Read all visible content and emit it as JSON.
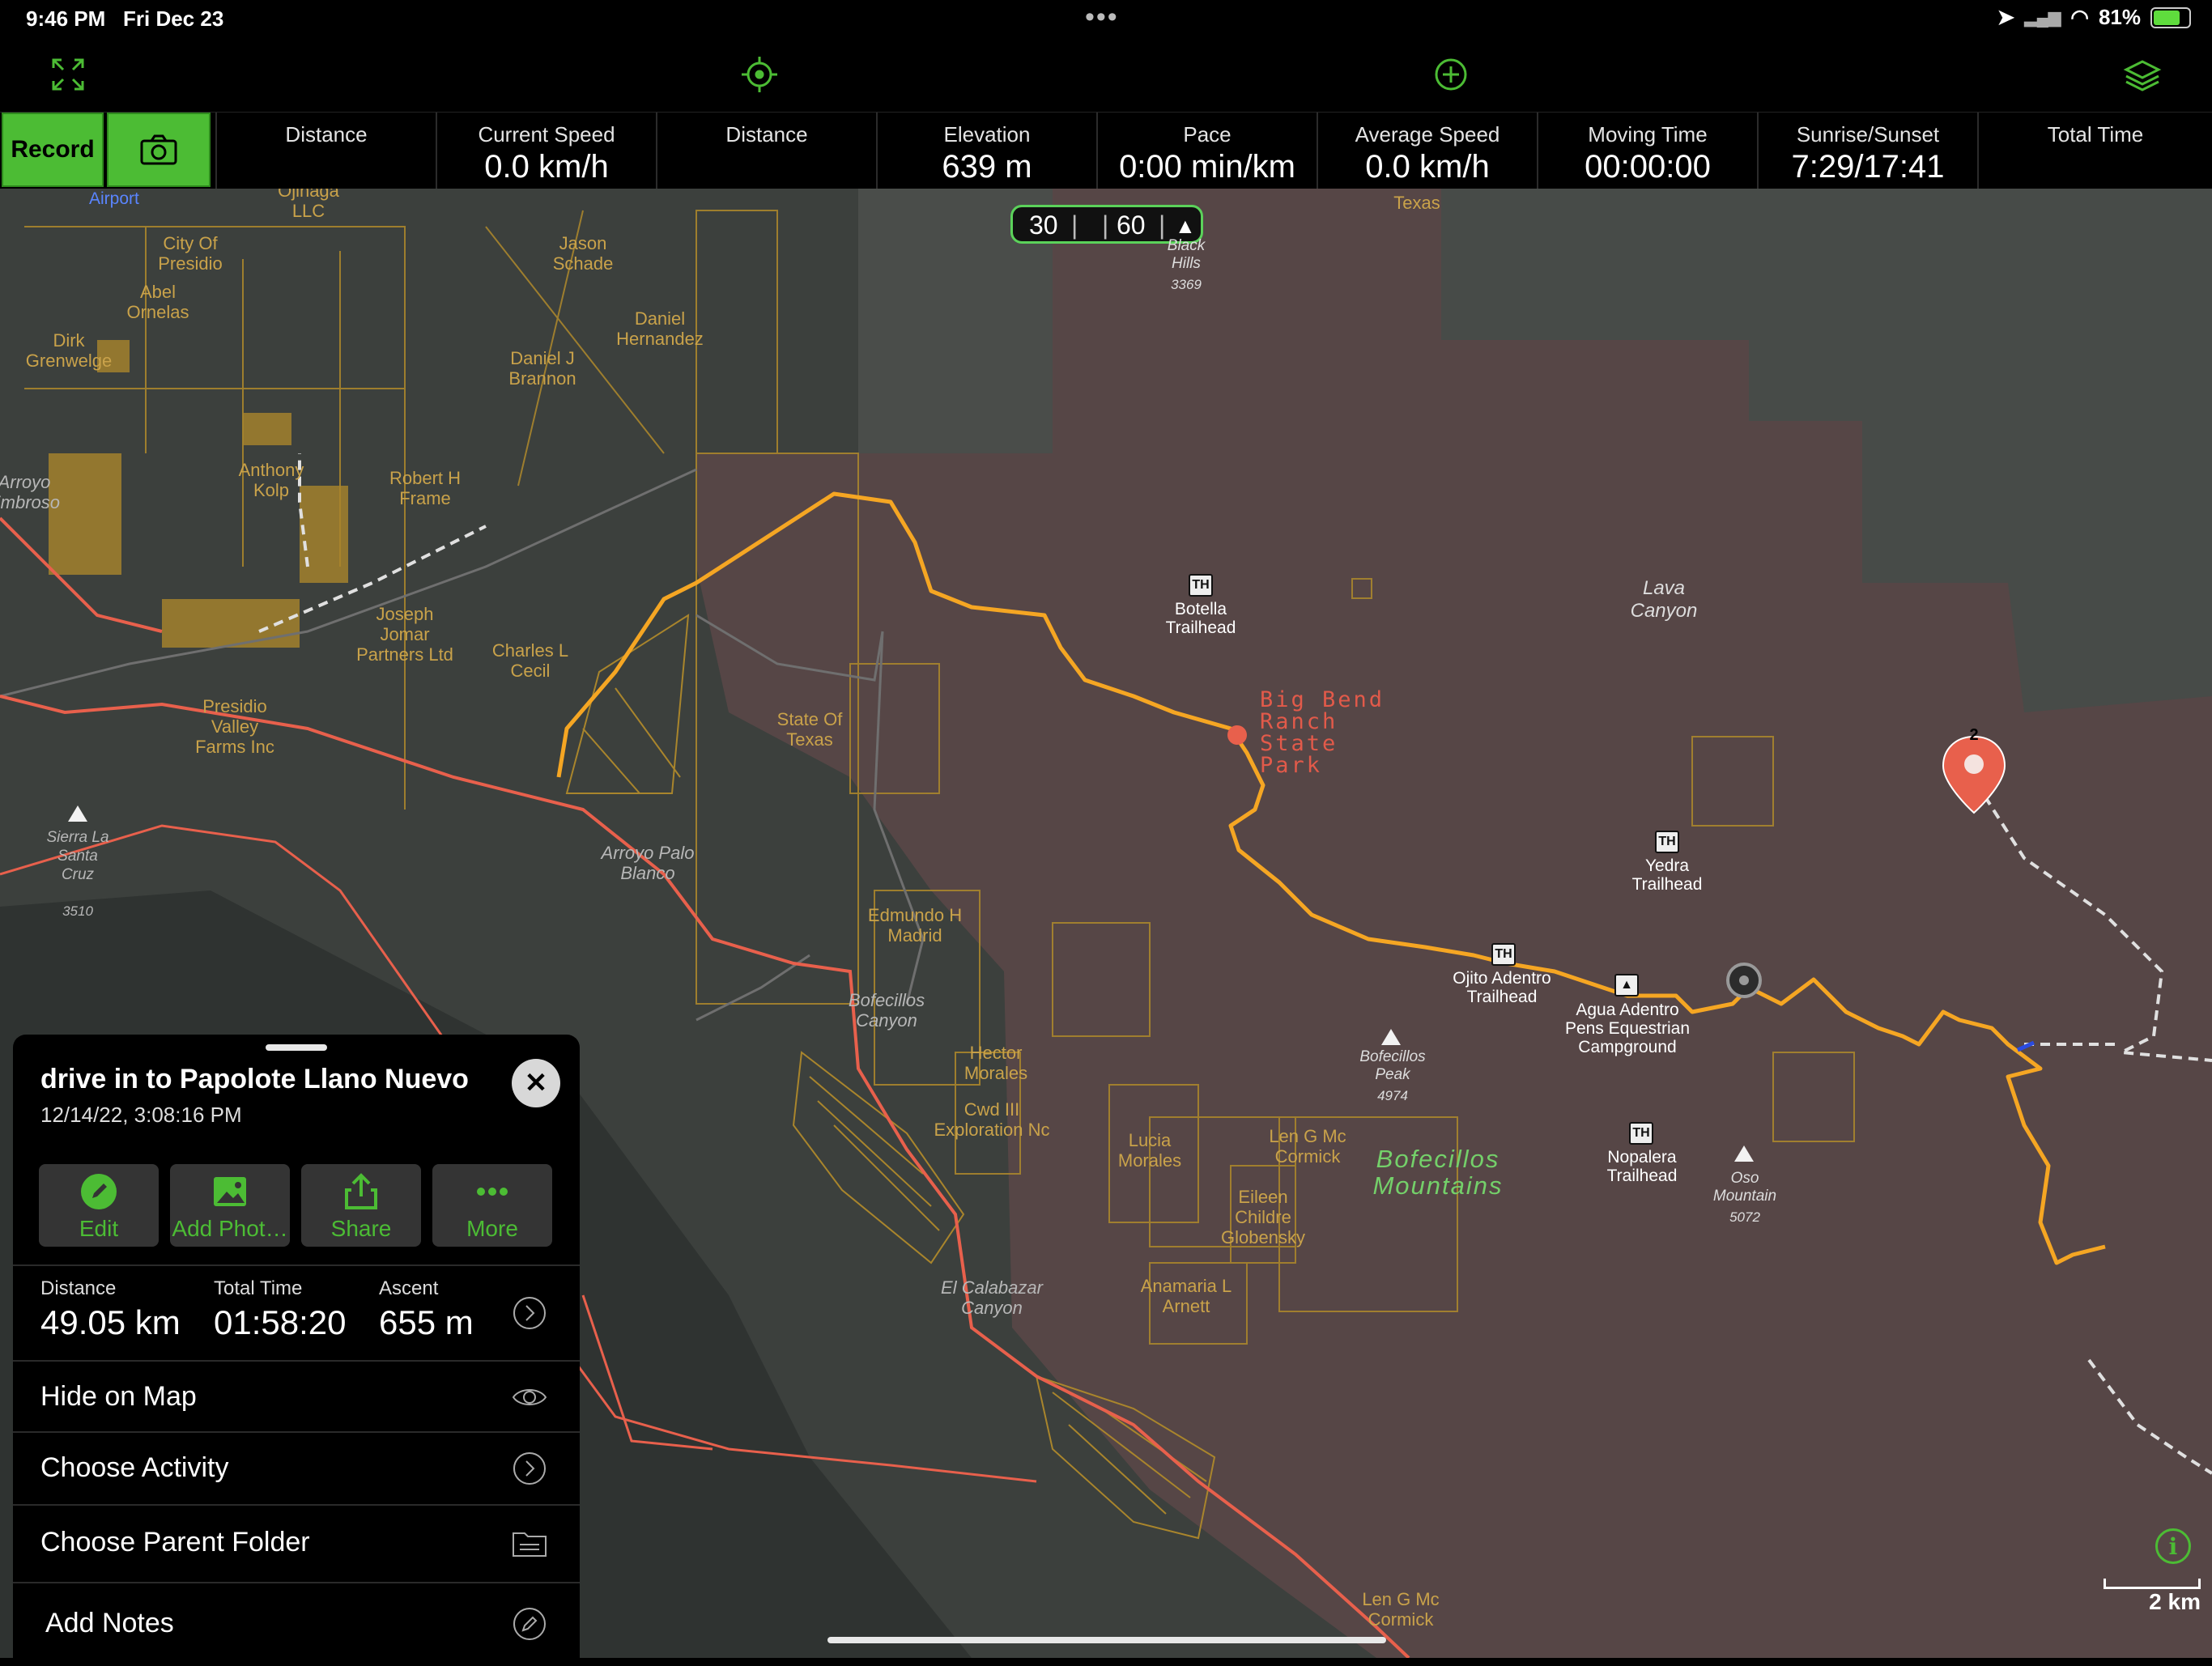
{
  "status_bar": {
    "time": "9:46 PM",
    "date": "Fri Dec 23",
    "dots": "•••",
    "battery": "81%",
    "battery_level": 0.81
  },
  "stats": {
    "record_label": "Record",
    "items": [
      {
        "label": "Distance",
        "value": ""
      },
      {
        "label": "Current Speed",
        "value": "0.0 km/h"
      },
      {
        "label": "Distance",
        "value": ""
      },
      {
        "label": "Elevation",
        "value": "639 m"
      },
      {
        "label": "Pace",
        "value": "0:00 min/km"
      },
      {
        "label": "Average Speed",
        "value": "0.0 km/h"
      },
      {
        "label": "Moving Time",
        "value": "00:00:00"
      },
      {
        "label": "Sunrise/Sunset",
        "value": "7:29/17:41"
      },
      {
        "label": "Total Time",
        "value": ""
      }
    ]
  },
  "map": {
    "scale_chip": {
      "a": "30",
      "b": "60"
    },
    "scale_bar": "2 km",
    "labels": {
      "airport": "Airport",
      "owner_llc": "Ojinaga LLC",
      "city_presidio": "City Of Presidio",
      "abel": "Abel Ornelas",
      "dirk": "Dirk Grenwelge",
      "jason": "Jason Schade",
      "daniel_h": "Daniel Hernandez",
      "daniel_j": "Daniel J Brannon",
      "anthony": "Anthony Kolp",
      "robert": "Robert H Frame",
      "joseph": "Joseph Jomar Partners Ltd",
      "charles": "Charles L Cecil",
      "presidio_valley": "Presidio Valley Farms Inc",
      "state_texas": "State Of Texas",
      "edmundo": "Edmundo H Madrid",
      "hector": "Hector Morales",
      "cwd": "Cwd III Exploration Nc",
      "lucia": "Lucia Morales",
      "len1": "Len G Mc Cormick",
      "eileen": "Eileen Childre Globensky",
      "anamaria": "Anamaria L Arnett",
      "len2": "Len G Mc Cormick",
      "texas_top": "Texas",
      "arroyo": "Arroyo Embroso",
      "sierra": "Sierra La Santa Cruz",
      "sierra_elev": "3510",
      "arroyo_palo": "Arroyo Palo Blanco",
      "bofecillos_canyon": "Bofecillos Canyon",
      "calabazar": "El Calabazar Canyon",
      "black_hills": "Black Hills",
      "black_hills_elev": "3369",
      "lava": "Lava Canyon",
      "botella": "Botella Trailhead",
      "yedra": "Yedra Trailhead",
      "ojito": "Ojito Adentro Trailhead",
      "agua": "Agua Adentro Pens Equestrian Campground",
      "bofecillos_peak": "Bofecillos Peak",
      "bofecillos_peak_elev": "4974",
      "nopalera": "Nopalera Trailhead",
      "oso": "Oso Mountain",
      "oso_elev": "5072",
      "park": "Big Bend Ranch State Park",
      "mountains": "Bofecillos Mountains",
      "marker": "2",
      "th": "TH"
    },
    "colors": {
      "track": "#f5a623",
      "road": "#e8604c",
      "park": "#5b4a4a",
      "boundary": "#a9852c"
    }
  },
  "panel": {
    "title": "drive in to Papolote Llano Nuevo",
    "subtitle": "12/14/22, 3:08:16 PM",
    "actions": [
      {
        "label": "Edit",
        "icon": "pencil-icon"
      },
      {
        "label": "Add Phot…",
        "icon": "photo-icon"
      },
      {
        "label": "Share",
        "icon": "share-icon"
      },
      {
        "label": "More",
        "icon": "more-icon"
      }
    ],
    "stats": [
      {
        "label": "Distance",
        "value": "49.05 km"
      },
      {
        "label": "Total Time",
        "value": "01:58:20"
      },
      {
        "label": "Ascent",
        "value": "655 m"
      }
    ],
    "rows": {
      "hide": "Hide on Map",
      "activity": "Choose Activity",
      "folder": "Choose Parent Folder",
      "notes": "Add Notes"
    }
  }
}
